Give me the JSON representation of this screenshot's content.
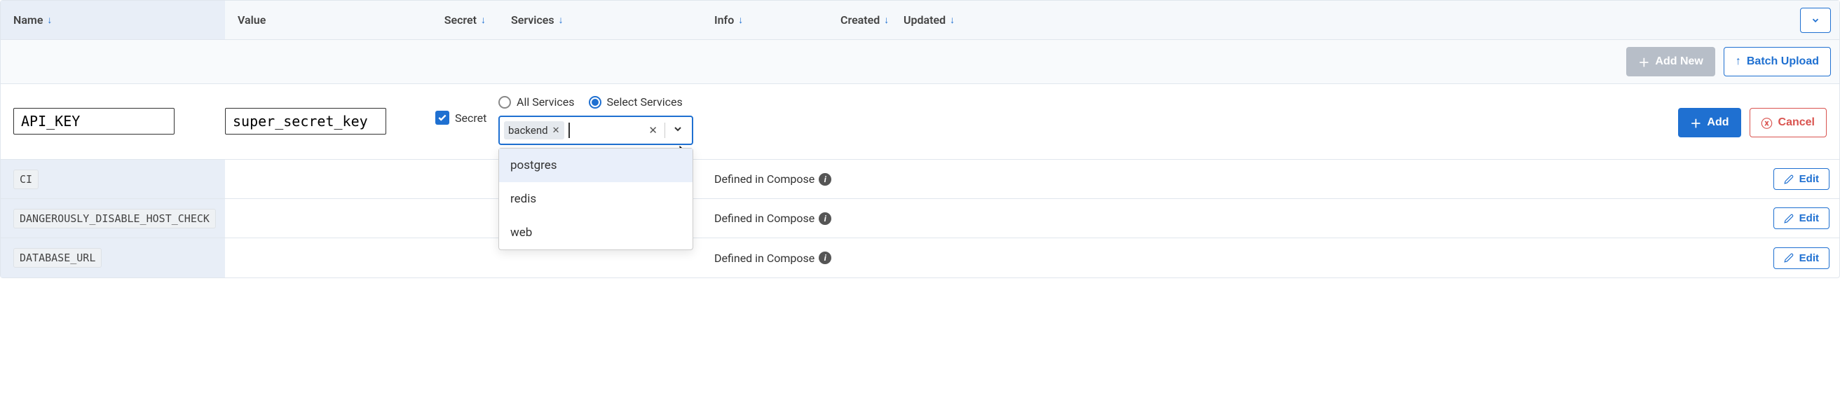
{
  "columns": {
    "name": "Name",
    "value": "Value",
    "secret": "Secret",
    "services": "Services",
    "info": "Info",
    "created": "Created",
    "updated": "Updated"
  },
  "action_bar": {
    "add_new": "Add New",
    "batch_upload": "Batch Upload"
  },
  "edit_panel": {
    "name_value": "API_KEY",
    "value_value": "super_secret_key",
    "secret_label": "Secret",
    "secret_checked": true,
    "radio_all": "All Services",
    "radio_select": "Select Services",
    "selected_service": "backend",
    "dropdown_options": [
      "postgres",
      "redis",
      "web"
    ],
    "add_btn": "Add",
    "cancel_btn": "Cancel"
  },
  "rows": [
    {
      "name": "CI",
      "info": "Defined in Compose",
      "edit": "Edit"
    },
    {
      "name": "DANGEROUSLY_DISABLE_HOST_CHECK",
      "info": "Defined in Compose",
      "edit": "Edit"
    },
    {
      "name": "DATABASE_URL",
      "info": "Defined in Compose",
      "edit": "Edit"
    }
  ]
}
